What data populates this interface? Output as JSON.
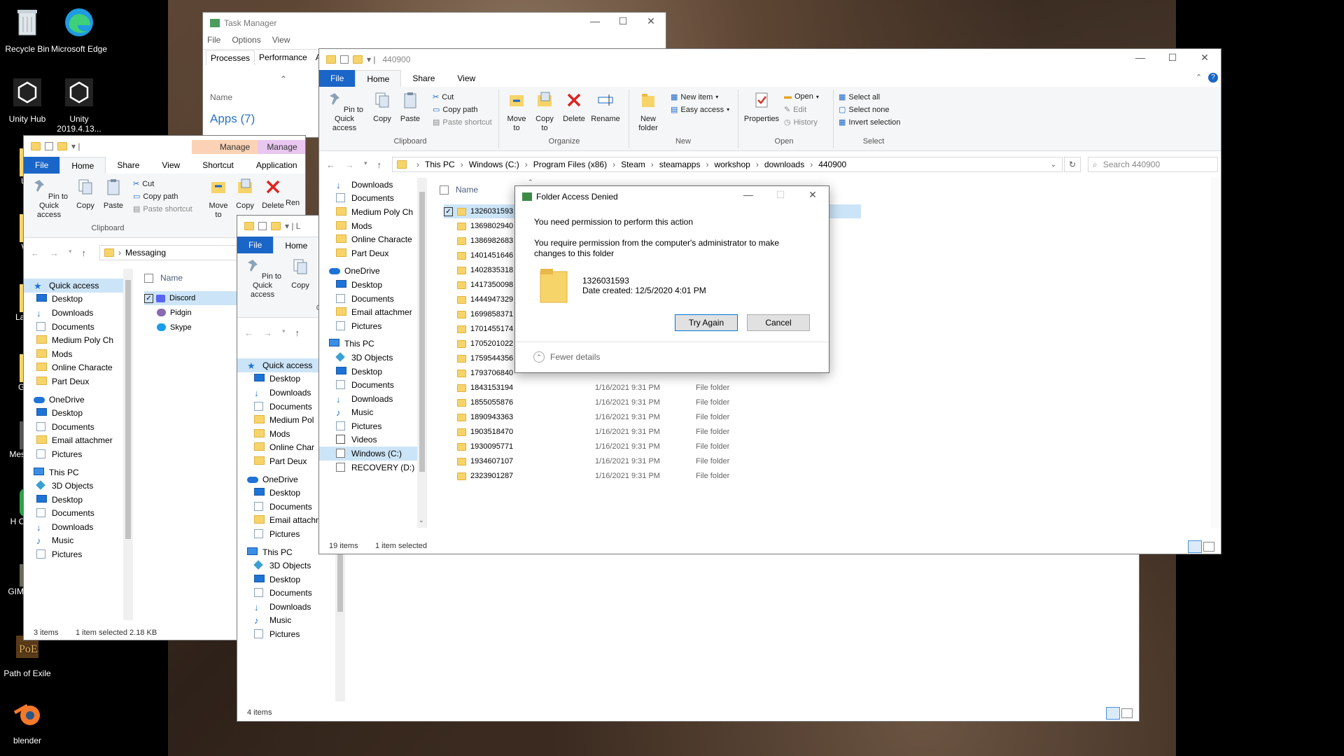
{
  "desktop": {
    "icons": [
      {
        "label": "Recycle Bin"
      },
      {
        "label": "Microsoft Edge"
      },
      {
        "label": "Unity Hub"
      },
      {
        "label": "Unity 2019.4.13..."
      },
      {
        "label": "Path of Exile"
      },
      {
        "label": "blender"
      },
      {
        "label": "Ut"
      },
      {
        "label": "W"
      },
      {
        "label": "Lau"
      },
      {
        "label": "Ga"
      },
      {
        "label": "Mess"
      },
      {
        "label": "H Ch"
      },
      {
        "label": "GIMP"
      }
    ]
  },
  "task_manager": {
    "title": "Task Manager",
    "menu": [
      "File",
      "Options",
      "View"
    ],
    "tabs": [
      "Processes",
      "Performance",
      "Ap"
    ],
    "col_name": "Name",
    "group": "Apps (7)"
  },
  "explorer_messaging": {
    "tabs": {
      "file": "File",
      "home": "Home",
      "share": "Share",
      "view": "View",
      "manage": "Manage",
      "shortcut_tools": "Shortcut Tools",
      "manage2": "Manage",
      "app_tools": "Application To"
    },
    "ribbon": {
      "pin": "Pin to Quick access",
      "copy": "Copy",
      "paste": "Paste",
      "cut": "Cut",
      "copy_path": "Copy path",
      "paste_shortcut": "Paste shortcut",
      "clipboard": "Clipboard",
      "move_to": "Move to",
      "copy_to": "Copy",
      "delete": "Delete",
      "rename": "Ren"
    },
    "path": "Messaging",
    "col_name": "Name",
    "nav": [
      "Quick access",
      "Desktop",
      "Downloads",
      "Documents",
      "Medium Poly Ch",
      "Mods",
      "Online Characte",
      "Part Deux",
      "OneDrive",
      "Desktop",
      "Documents",
      "Email attachmer",
      "Pictures",
      "This PC",
      "3D Objects",
      "Desktop",
      "Documents",
      "Downloads",
      "Music",
      "Pictures"
    ],
    "files": [
      "Discord",
      "Pidgin",
      "Skype"
    ],
    "status_items": "3 items",
    "status_sel": "1 item selected  2.18 KB"
  },
  "explorer_mid": {
    "tabs": {
      "file": "File",
      "home": "Home"
    },
    "ribbon": {
      "pin": "Pin to Quick access",
      "copy": "Copy",
      "cl": "Cli"
    },
    "path": "L",
    "nav": [
      "Quick access",
      "Desktop",
      "Downloads",
      "Documents",
      "Medium Pol",
      "Mods",
      "Online Char",
      "Part Deux",
      "OneDrive",
      "Desktop",
      "Documents",
      "Email attachmer",
      "Pictures",
      "This PC",
      "3D Objects",
      "Desktop",
      "Documents",
      "Downloads",
      "Music",
      "Pictures"
    ],
    "status_items": "4 items"
  },
  "explorer_main": {
    "title": "440900",
    "tabs": {
      "file": "File",
      "home": "Home",
      "share": "Share",
      "view": "View"
    },
    "ribbon": {
      "pin": "Pin to Quick access",
      "copy": "Copy",
      "paste": "Paste",
      "cut": "Cut",
      "copy_path": "Copy path",
      "paste_shortcut": "Paste shortcut",
      "clipboard": "Clipboard",
      "move_to": "Move to",
      "copy_to": "Copy to",
      "delete": "Delete",
      "rename": "Rename",
      "organize": "Organize",
      "new_folder": "New folder",
      "new_item": "New item",
      "easy_access": "Easy access",
      "new": "New",
      "properties": "Properties",
      "open": "Open",
      "edit": "Edit",
      "history": "History",
      "open_grp": "Open",
      "select_all": "Select all",
      "select_none": "Select none",
      "invert": "Invert selection",
      "select": "Select"
    },
    "breadcrumb": [
      "This PC",
      "Windows (C:)",
      "Program Files (x86)",
      "Steam",
      "steamapps",
      "workshop",
      "downloads",
      "440900"
    ],
    "search_placeholder": "Search 440900",
    "col_name": "Name",
    "nav": [
      "Downloads",
      "Documents",
      "Medium Poly Ch",
      "Mods",
      "Online Characte",
      "Part Deux",
      "OneDrive",
      "Desktop",
      "Documents",
      "Email attachmer",
      "Pictures",
      "This PC",
      "3D Objects",
      "Desktop",
      "Documents",
      "Downloads",
      "Music",
      "Pictures",
      "Videos",
      "Windows (C:)",
      "RECOVERY (D:)"
    ],
    "files": [
      {
        "name": "1326031593",
        "date": "",
        "type": ""
      },
      {
        "name": "1369802940",
        "date": "",
        "type": ""
      },
      {
        "name": "1386982683",
        "date": "",
        "type": ""
      },
      {
        "name": "1401451646",
        "date": "",
        "type": ""
      },
      {
        "name": "1402835318",
        "date": "",
        "type": ""
      },
      {
        "name": "1417350098",
        "date": "",
        "type": ""
      },
      {
        "name": "1444947329",
        "date": "",
        "type": ""
      },
      {
        "name": "1699858371",
        "date": "",
        "type": ""
      },
      {
        "name": "1701455174",
        "date": "",
        "type": ""
      },
      {
        "name": "1705201022",
        "date": "",
        "type": ""
      },
      {
        "name": "1759544356",
        "date": "",
        "type": ""
      },
      {
        "name": "1793706840",
        "date": "",
        "type": ""
      },
      {
        "name": "1843153194",
        "date": "1/16/2021 9:31 PM",
        "type": "File folder"
      },
      {
        "name": "1855055876",
        "date": "1/16/2021 9:31 PM",
        "type": "File folder"
      },
      {
        "name": "1890943363",
        "date": "1/16/2021 9:31 PM",
        "type": "File folder"
      },
      {
        "name": "1903518470",
        "date": "1/16/2021 9:31 PM",
        "type": "File folder"
      },
      {
        "name": "1930095771",
        "date": "1/16/2021 9:31 PM",
        "type": "File folder"
      },
      {
        "name": "1934607107",
        "date": "1/16/2021 9:31 PM",
        "type": "File folder"
      },
      {
        "name": "2323901287",
        "date": "1/16/2021 9:31 PM",
        "type": "File folder"
      }
    ],
    "status_items": "19 items",
    "status_sel": "1 item selected"
  },
  "dialog": {
    "title": "Folder Access Denied",
    "heading": "You need permission to perform this action",
    "message": "You require permission from the computer's administrator to make changes to this folder",
    "folder_name": "1326031593",
    "date_created": "Date created: 12/5/2020 4:01 PM",
    "try_again": "Try Again",
    "cancel": "Cancel",
    "fewer_details": "Fewer details"
  }
}
